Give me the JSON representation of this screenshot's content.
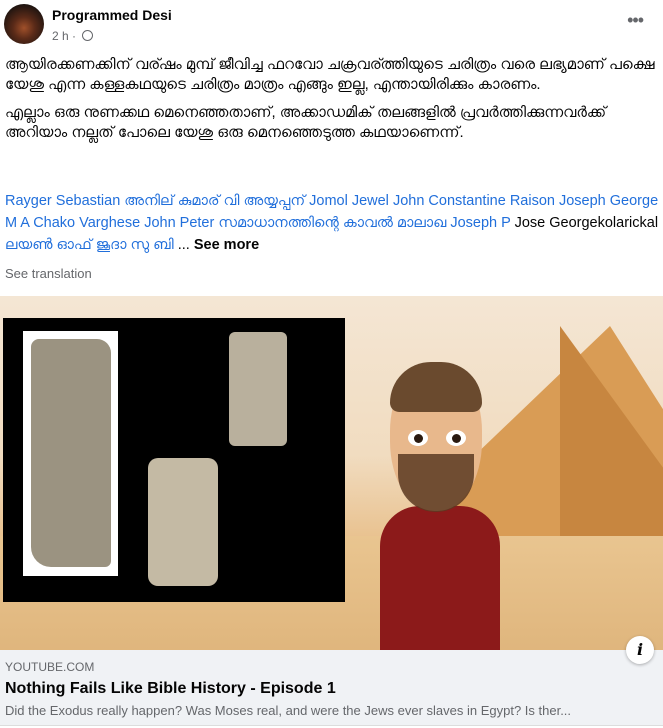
{
  "header": {
    "author": "Programmed Desi",
    "time": "2 h",
    "separator": "·",
    "privacy_icon": "globe-icon",
    "more_label": "•••"
  },
  "post": {
    "paragraphs": [
      "ആയിരക്കണക്കിന് വര്ഷം മുമ്പ് ജീവിച്ച ഫറവോ ചക്രവര്ത്തിയുടെ ചരിത്രം വരെ ലഭ്യമാണ് പക്ഷെ യേശു എന്ന കള്ളകഥയുടെ ചരിത്രം മാത്രം എങ്ങും ഇല്ല, എന്തായിരിക്കും കാരണം.",
      "എല്ലാം ഒരു നുണക്കഥ മെനെഞ്ഞതാണ്, അക്കാഡമിക് തലങ്ങളിൽ പ്രവർത്തിക്കുന്നവർക്ക് അറിയാം നല്ലത് പോലെ  യേശു ഒരു മെനഞ്ഞെടുത്ത കഥയാണെന്ന്."
    ]
  },
  "tags": [
    "Rayger Sebastian",
    "അനില് കുമാര് വി അയ്യപ്പന്",
    "Jomol Jewel",
    "John Constantine",
    "Raison Joseph George",
    "M A Chako Varghese",
    "John Peter",
    "സമാധാനത്തിന്റെ കാവൽ മാലാഖ",
    "Joseph P"
  ],
  "plain_name": "Jose Georgekolarickal",
  "last_tag": "ലയൺ ഓഫ് ജൂദാ സു ബി",
  "ellipsis": "...",
  "see_more": "See more",
  "see_translation": "See translation",
  "link": {
    "domain": "YOUTUBE.COM",
    "title": "Nothing Fails Like Bible History - Episode 1",
    "description": "Did the Exodus really happen? Was Moses real, and were the Jews ever slaves in Egypt? Is ther...",
    "info_label": "i"
  }
}
